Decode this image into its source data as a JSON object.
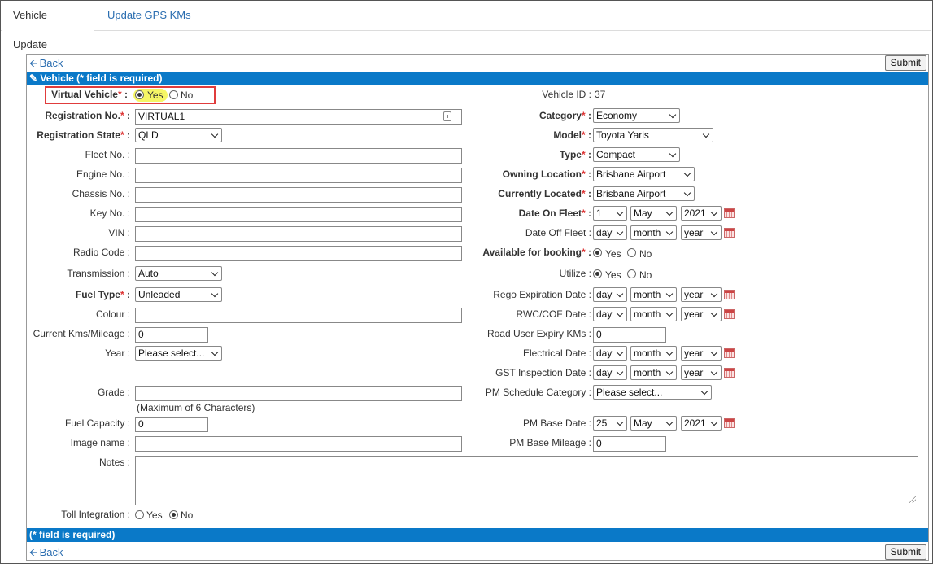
{
  "tabs": [
    "Vehicle Update",
    "Update GPS KMs"
  ],
  "back_label": "Back",
  "submit_label": "Submit",
  "header_bar": "Vehicle (* field is required)",
  "footer_bar": "(* field is required)",
  "left": {
    "virtual_vehicle": {
      "label": "Virtual Vehicle",
      "yes": "Yes",
      "no": "No",
      "selected": "Yes"
    },
    "registration_no": {
      "label": "Registration No.",
      "value": "VIRTUAL1"
    },
    "registration_state": {
      "label": "Registration State",
      "value": "QLD"
    },
    "fleet_no": {
      "label": "Fleet No.",
      "value": ""
    },
    "engine_no": {
      "label": "Engine No.",
      "value": ""
    },
    "chassis_no": {
      "label": "Chassis No.",
      "value": ""
    },
    "key_no": {
      "label": "Key No.",
      "value": ""
    },
    "vin": {
      "label": "VIN",
      "value": ""
    },
    "radio_code": {
      "label": "Radio Code",
      "value": ""
    },
    "transmission": {
      "label": "Transmission",
      "value": "Auto"
    },
    "fuel_type": {
      "label": "Fuel Type",
      "value": "Unleaded"
    },
    "colour": {
      "label": "Colour",
      "value": ""
    },
    "current_kms": {
      "label": "Current Kms/Mileage",
      "value": "0"
    },
    "year": {
      "label": "Year",
      "value": "Please select..."
    },
    "grade": {
      "label": "Grade",
      "value": "",
      "hint": "(Maximum of 6 Characters)"
    },
    "fuel_capacity": {
      "label": "Fuel Capacity",
      "value": "0"
    },
    "image_name": {
      "label": "Image name",
      "value": ""
    },
    "notes": {
      "label": "Notes",
      "value": ""
    },
    "toll_integration": {
      "label": "Toll Integration",
      "yes": "Yes",
      "no": "No",
      "selected": "No"
    }
  },
  "right": {
    "vehicle_id": {
      "label": "Vehicle ID",
      "value": "37"
    },
    "category": {
      "label": "Category",
      "value": "Economy"
    },
    "model": {
      "label": "Model",
      "value": "Toyota Yaris"
    },
    "type": {
      "label": "Type",
      "value": "Compact"
    },
    "owning_location": {
      "label": "Owning Location",
      "value": "Brisbane Airport"
    },
    "currently_located": {
      "label": "Currently Located",
      "value": "Brisbane Airport"
    },
    "date_on_fleet": {
      "label": "Date On Fleet",
      "day": "1",
      "month": "May",
      "year": "2021"
    },
    "date_off_fleet": {
      "label": "Date Off Fleet",
      "day": "day",
      "month": "month",
      "year": "year"
    },
    "available_for_booking": {
      "label": "Available for booking",
      "yes": "Yes",
      "no": "No",
      "selected": "Yes"
    },
    "utilize": {
      "label": "Utilize",
      "yes": "Yes",
      "no": "No",
      "selected": "Yes"
    },
    "rego_expiration": {
      "label": "Rego Expiration Date",
      "day": "day",
      "month": "month",
      "year": "year"
    },
    "rwc_cof": {
      "label": "RWC/COF Date",
      "day": "day",
      "month": "month",
      "year": "year"
    },
    "road_user_expiry": {
      "label": "Road User Expiry KMs",
      "value": "0"
    },
    "electrical_date": {
      "label": "Electrical Date",
      "day": "day",
      "month": "month",
      "year": "year"
    },
    "gst_inspection": {
      "label": "GST Inspection Date",
      "day": "day",
      "month": "month",
      "year": "year"
    },
    "pm_schedule_category": {
      "label": "PM Schedule Category",
      "value": "Please select..."
    },
    "pm_base_date": {
      "label": "PM Base Date",
      "day": "25",
      "month": "May",
      "year": "2021"
    },
    "pm_base_mileage": {
      "label": "PM Base Mileage",
      "value": "0"
    }
  }
}
